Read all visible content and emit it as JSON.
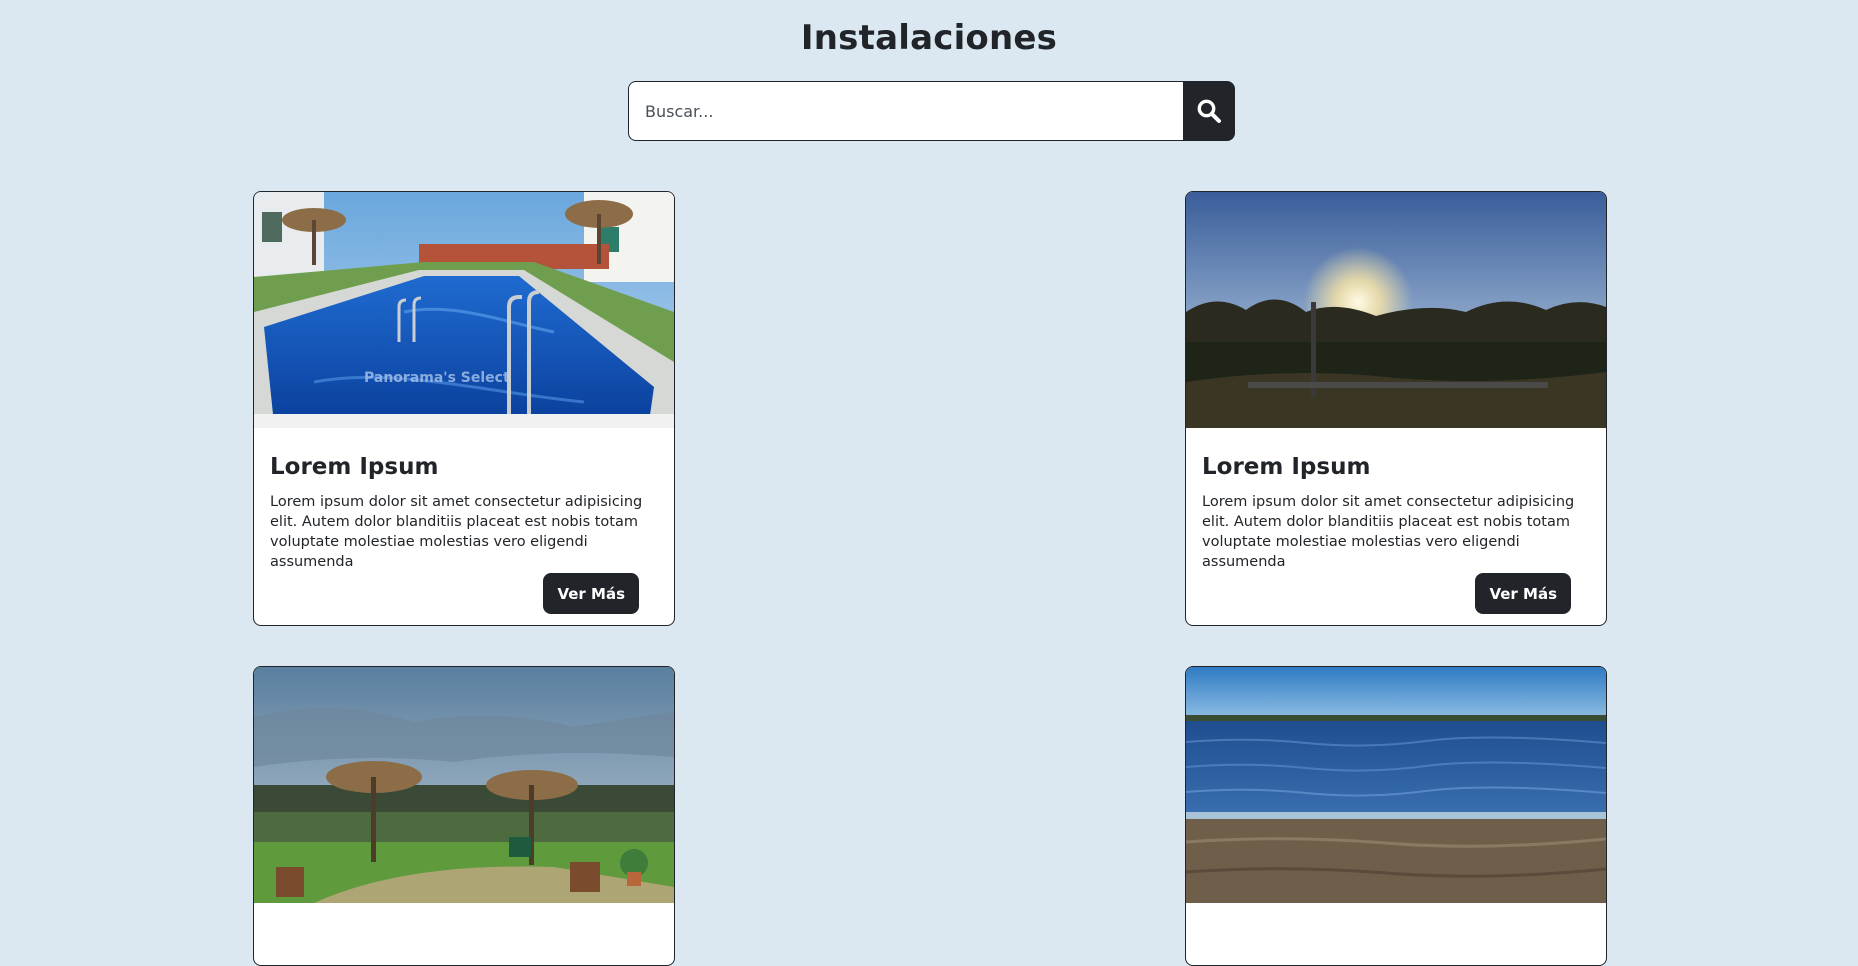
{
  "page": {
    "title": "Instalaciones"
  },
  "search": {
    "placeholder": "Buscar...",
    "button_icon": "search-icon"
  },
  "cards": [
    {
      "title": "Lorem Ipsum",
      "text": "Lorem ipsum dolor sit amet consectetur adipisicing elit. Autem dolor blanditiis placeat est nobis totam voluptate molestiae molestias vero eligendi assumenda",
      "button_label": "Ver Más",
      "image": "hotel-pool-photo",
      "image_overlay_text": "Panorama's Select"
    },
    {
      "title": "Lorem Ipsum",
      "text": "Lorem ipsum dolor sit amet consectetur adipisicing elit. Autem dolor blanditiis placeat est nobis totam voluptate molestiae molestias vero eligendi assumenda",
      "button_label": "Ver Más",
      "image": "sunset-garden-photo"
    },
    {
      "image": "garden-umbrellas-photo"
    },
    {
      "image": "lake-shore-photo"
    }
  ],
  "colors": {
    "background": "#dbe8f2",
    "dark": "#212529",
    "card": "#ffffff"
  }
}
